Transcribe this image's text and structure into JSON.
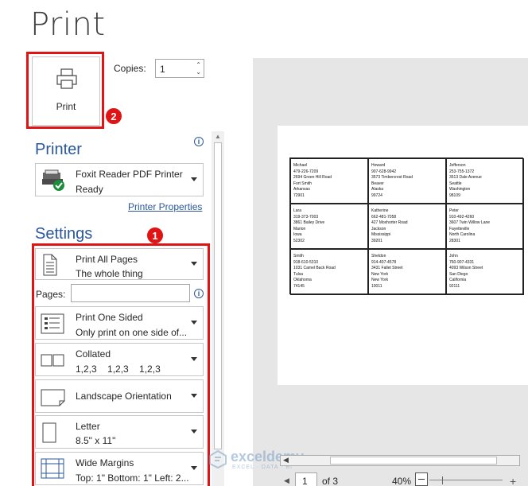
{
  "title": "Print",
  "print_button": {
    "label": "Print"
  },
  "copies": {
    "label": "Copies:",
    "value": "1"
  },
  "printer_section": {
    "title": "Printer",
    "printer_name": "Foxit Reader PDF Printer",
    "printer_status": "Ready",
    "properties_link": "Printer Properties"
  },
  "settings_section": {
    "title": "Settings",
    "pages_label": "Pages:",
    "pages_value": "",
    "items": [
      {
        "line1": "Print All Pages",
        "line2": "The whole thing",
        "icon": "document-pages-icon"
      },
      {
        "line1": "Print One Sided",
        "line2": "Only print on one side of...",
        "icon": "one-sided-icon"
      },
      {
        "line1": "Collated",
        "line2": "1,2,3    1,2,3    1,2,3",
        "icon": "collated-icon"
      },
      {
        "line1": "Landscape Orientation",
        "line2": "",
        "icon": "landscape-icon"
      },
      {
        "line1": "Letter",
        "line2": "8.5\" x 11\"",
        "icon": "letter-paper-icon"
      },
      {
        "line1": "Wide Margins",
        "line2": "Top: 1\" Bottom: 1\" Left: 2...",
        "icon": "margins-icon"
      }
    ]
  },
  "annotations": {
    "badge_1": "1",
    "badge_2": "2"
  },
  "preview": {
    "labels": [
      [
        "Michael",
        "479-226-7209",
        "2694 Green Hill Road",
        "Fort Smith",
        "Arkansas",
        "72901"
      ],
      [
        "Howard",
        "907-628-9942",
        "3573 Timbercrest Road",
        "Beaver",
        "Alaska",
        "99724"
      ],
      [
        "Jefferson",
        "253-755-1372",
        "3513 Dale Avenue",
        "Seattle",
        "Washington",
        "98109"
      ],
      [
        "Lara",
        "319-373-7003",
        "3861 Bailey Drive",
        "Marion",
        "Iowa",
        "52302"
      ],
      [
        "Katherine",
        "662-481-7058",
        "427 Moxhorter Road",
        "Jackson",
        "Mississippi",
        "39201"
      ],
      [
        "Peter",
        "910-492-4260",
        "3607 Twin Willow Lane",
        "Fayetteville",
        "North Carolina",
        "28301"
      ],
      [
        "Smith",
        "918-610-5310",
        "1031 Camel Back Road",
        "Tulsa",
        "Oklahoma",
        "74145"
      ],
      [
        "Sheldon",
        "914-407-4578",
        "3431 Fallet Street",
        "New York",
        "New York",
        "10011"
      ],
      [
        "John",
        "760-907-4331",
        "4093 Wilson Street",
        "San Diego",
        "California",
        "92111"
      ]
    ]
  },
  "navigation": {
    "page_current": "1",
    "page_total": "of 3",
    "zoom": "40%"
  },
  "watermark": {
    "name": "exceldemy",
    "tagline": "EXCEL · DATA · BI"
  },
  "colors": {
    "accent": "#2b579a",
    "highlight": "#e01414",
    "preview_bg": "#e6e6e6"
  }
}
